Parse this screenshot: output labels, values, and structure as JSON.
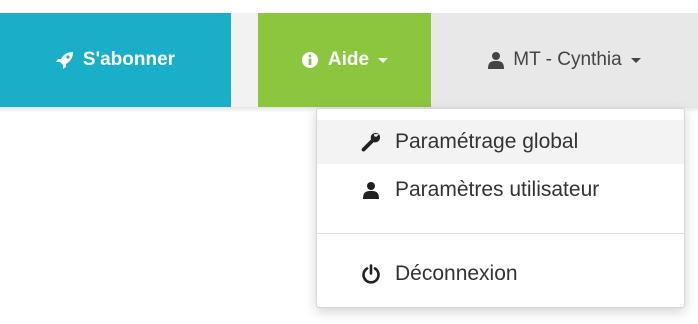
{
  "navbar": {
    "subscribe_label": "S'abonner",
    "help_label": "Aide",
    "user_label": "MT - Cynthia"
  },
  "user_menu": {
    "items": [
      {
        "label": "Paramétrage global",
        "icon": "wrench-icon"
      },
      {
        "label": "Paramètres utilisateur",
        "icon": "user-icon"
      },
      {
        "label": "Déconnexion",
        "icon": "power-icon"
      }
    ]
  },
  "colors": {
    "subscribe": "#1aafc9",
    "help": "#8cc63f",
    "user": "#e8e8e8"
  }
}
